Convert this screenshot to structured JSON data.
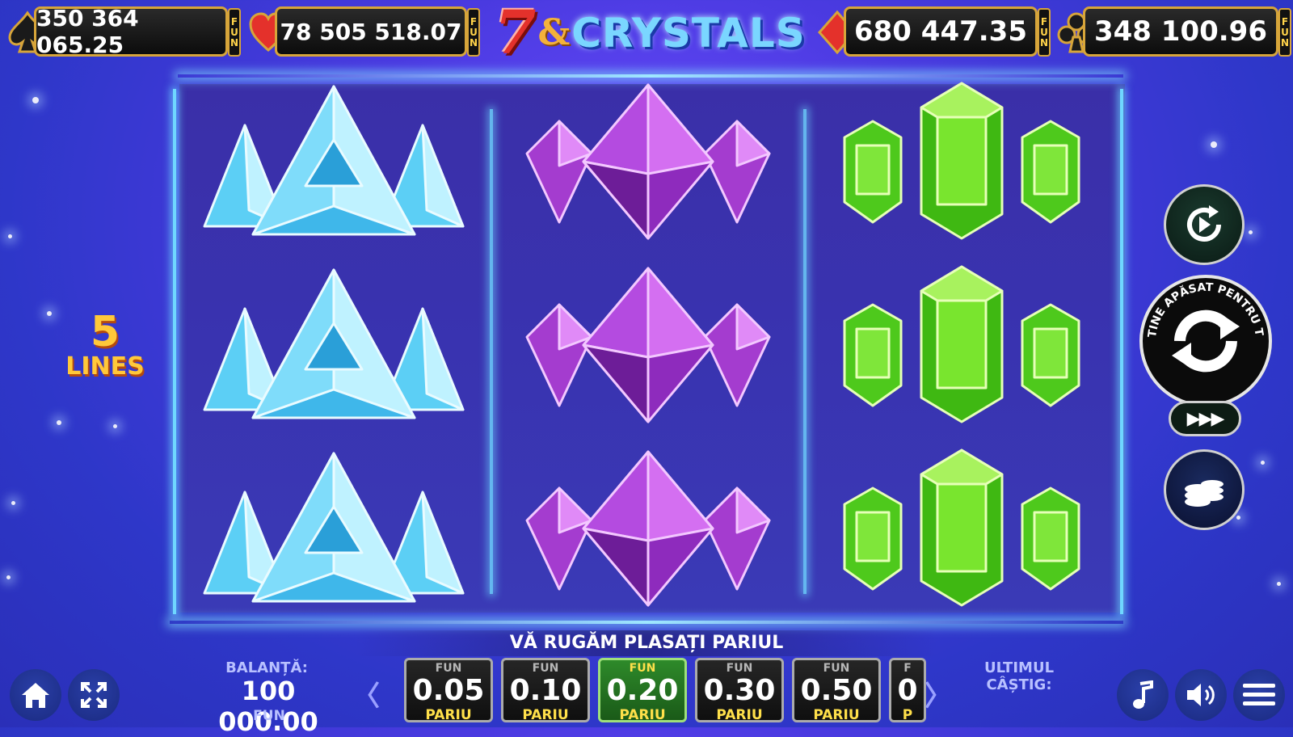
{
  "jackpots": [
    {
      "suit": "spade-icon",
      "value": "350 364 065.25",
      "badge": "FUN"
    },
    {
      "suit": "heart-icon",
      "value": "78 505 518.07",
      "badge": "FUN"
    },
    {
      "suit": "diamond-icon",
      "value": "680 447.35",
      "badge": "FUN"
    },
    {
      "suit": "club-icon",
      "value": "348 100.96",
      "badge": "FUN"
    }
  ],
  "logo": {
    "seven": "7",
    "amp": "&",
    "name": "CRYSTALS"
  },
  "paylines": {
    "count": "5",
    "label": "LINES"
  },
  "reels": [
    [
      "blue-triangle-crystal",
      "blue-triangle-crystal",
      "blue-triangle-crystal"
    ],
    [
      "purple-gem-crystal",
      "purple-gem-crystal",
      "purple-gem-crystal"
    ],
    [
      "green-emerald-crystal",
      "green-emerald-crystal",
      "green-emerald-crystal"
    ]
  ],
  "controls": {
    "autoplay": "autoplay-icon",
    "spin_ring_text": "TINE APĂSAT PENTRU TURBO SPIN",
    "turbo": "▶▶▶",
    "bet_menu": "coins-icon"
  },
  "bottom": {
    "message": "VĂ RUGĂM PLASAȚI PARIUL",
    "balance_label": "BALANȚĂ:",
    "balance_value": "100 000.00",
    "balance_currency": "FUN",
    "last_win_label": "ULTIMUL CÂȘTIG:",
    "bets": [
      {
        "fun": "FUN",
        "value": "0.05",
        "label": "PARIU",
        "selected": false
      },
      {
        "fun": "FUN",
        "value": "0.10",
        "label": "PARIU",
        "selected": false
      },
      {
        "fun": "FUN",
        "value": "0.20",
        "label": "PARIU",
        "selected": true
      },
      {
        "fun": "FUN",
        "value": "0.30",
        "label": "PARIU",
        "selected": false
      },
      {
        "fun": "FUN",
        "value": "0.50",
        "label": "PARIU",
        "selected": false
      },
      {
        "fun": "F",
        "value": "0",
        "label": "P",
        "selected": false
      }
    ],
    "prev_arrow": "〈",
    "next_arrow": "〉",
    "buttons": [
      "home-icon",
      "fullscreen-icon",
      "music-icon",
      "sound-icon",
      "menu-icon"
    ]
  },
  "colors": {
    "accent_gold": "#d7a53a",
    "selected_bet": "#2e8a2a",
    "reel_glow": "#6fd7ff"
  }
}
